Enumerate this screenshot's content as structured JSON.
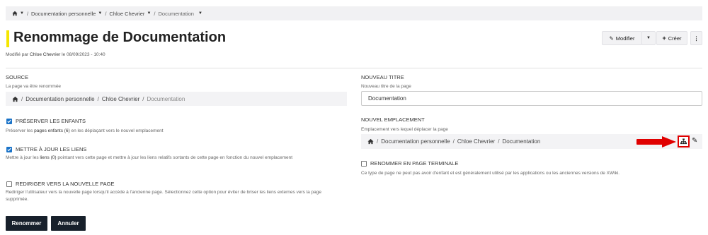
{
  "breadcrumb": {
    "items": [
      "Documentation personnelle",
      "Chloe Chevrier",
      "Documentation"
    ]
  },
  "header": {
    "title": "Renommage de Documentation",
    "meta_prefix": "Modifié par",
    "meta_user": "Chloe Chevrier",
    "meta_suffix": "le 08/09/2023 - 10:40"
  },
  "actions": {
    "modify": "Modifier",
    "create": "Créer"
  },
  "source": {
    "label": "SOURCE",
    "hint": "La page va être renommée",
    "path": [
      "Documentation personnelle",
      "Chloe Chevrier",
      "Documentation"
    ]
  },
  "options": {
    "preserve_children": {
      "label": "PRÉSERVER LES ENFANTS",
      "hint_prefix": "Préserver les",
      "hint_link": "pages enfants (6)",
      "hint_suffix": "en les déplaçant vers le nouvel emplacement",
      "checked": true
    },
    "update_links": {
      "label": "METTRE À JOUR LES LIENS",
      "hint_prefix": "Mettre à jour les",
      "hint_link": "liens (0)",
      "hint_suffix": "pointant vers cette page et mettre à jour les liens relatifs sortants de cette page en fonction du nouvel emplacement",
      "checked": true
    },
    "redirect": {
      "label": "REDIRIGER VERS LA NOUVELLE PAGE",
      "hint": "Rediriger l'utilisateur vers la nouvelle page lorsqu'il accède à l'ancienne page. Sélectionnez cette option pour éviter de briser les liens externes vers la page supprimée.",
      "checked": false
    }
  },
  "new_title": {
    "label": "NOUVEAU TITRE",
    "hint": "Nouveau titre de la page",
    "value": "Documentation"
  },
  "new_location": {
    "label": "NOUVEL EMPLACEMENT",
    "hint": "Emplacement vers lequel déplacer la page",
    "path": [
      "Documentation personnelle",
      "Chloe Chevrier",
      "Documentation"
    ]
  },
  "terminal": {
    "label": "RENOMMER EN PAGE TERMINALE",
    "hint": "Ce type de page ne peut pas avoir d'enfant et est généralement utilisé par les applications ou les anciennes versions de XWiki.",
    "checked": false
  },
  "buttons": {
    "rename": "Renommer",
    "cancel": "Annuler"
  },
  "colors": {
    "accent_bar": "#f5e600",
    "checkbox": "#1a73c8",
    "dark_button": "#17202b",
    "arrow": "#e00000"
  },
  "icons": [
    "home-icon",
    "pencil-icon",
    "plus-icon",
    "more-vertical-icon",
    "hierarchy-icon",
    "red-arrow-annotation"
  ]
}
